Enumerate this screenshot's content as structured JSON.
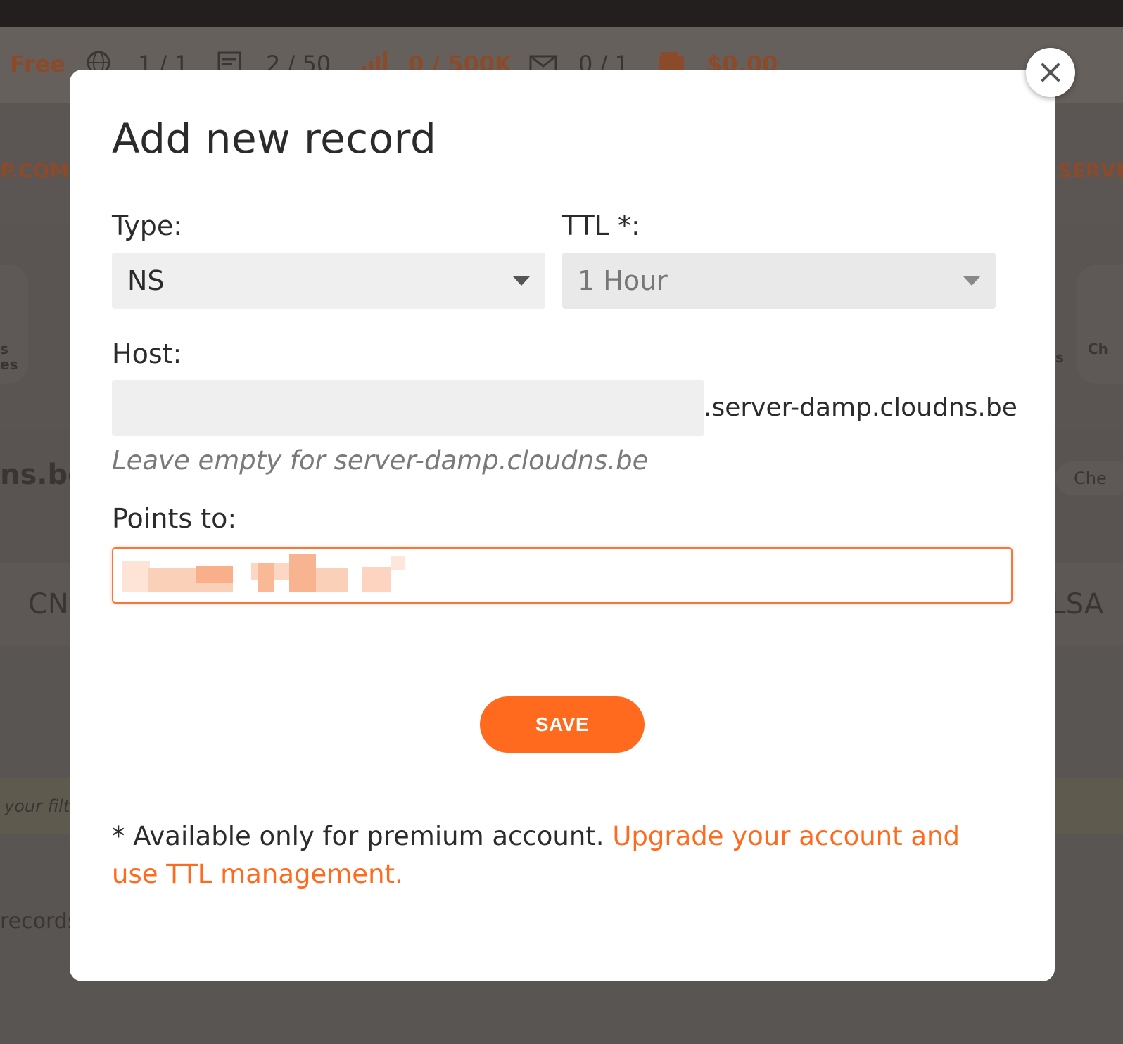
{
  "background": {
    "stats": [
      {
        "label": "Free",
        "kind": "plan"
      },
      {
        "label": "1 / 1",
        "icon": "globe-icon"
      },
      {
        "label": "2 / 50",
        "icon": "records-icon"
      },
      {
        "label": "0 / 500K",
        "icon": "bar-chart-icon"
      },
      {
        "label": "0 / 1",
        "icon": "mail-icon"
      },
      {
        "label": "$0.00",
        "icon": "wallet-icon"
      }
    ],
    "left_domain": "P.COM",
    "right_servers": "R SERVE",
    "left_zone": "ns.be",
    "right_check": "Che",
    "left_cn": "CN",
    "right_tlsa": "TLSA",
    "left_filter": "your filt",
    "left_records": "records",
    "left_small_1": "s",
    "left_small_2": "es",
    "right_small_1": "s",
    "right_small_2": "Ch"
  },
  "modal": {
    "title": "Add new record",
    "type_label": "Type:",
    "type_value": "NS",
    "ttl_label": "TTL *:",
    "ttl_value": "1 Hour",
    "host_label": "Host:",
    "host_value": "",
    "host_suffix": ".server-damp.cloudns.be",
    "host_hint": "Leave empty for server-damp.cloudns.be",
    "points_label": "Points to:",
    "save_label": "SAVE",
    "note_text": "* Available only for premium account. ",
    "note_link": "Upgrade your account and use TTL management."
  },
  "colors": {
    "accent": "#ff6a1f",
    "overlay": "#595553"
  }
}
